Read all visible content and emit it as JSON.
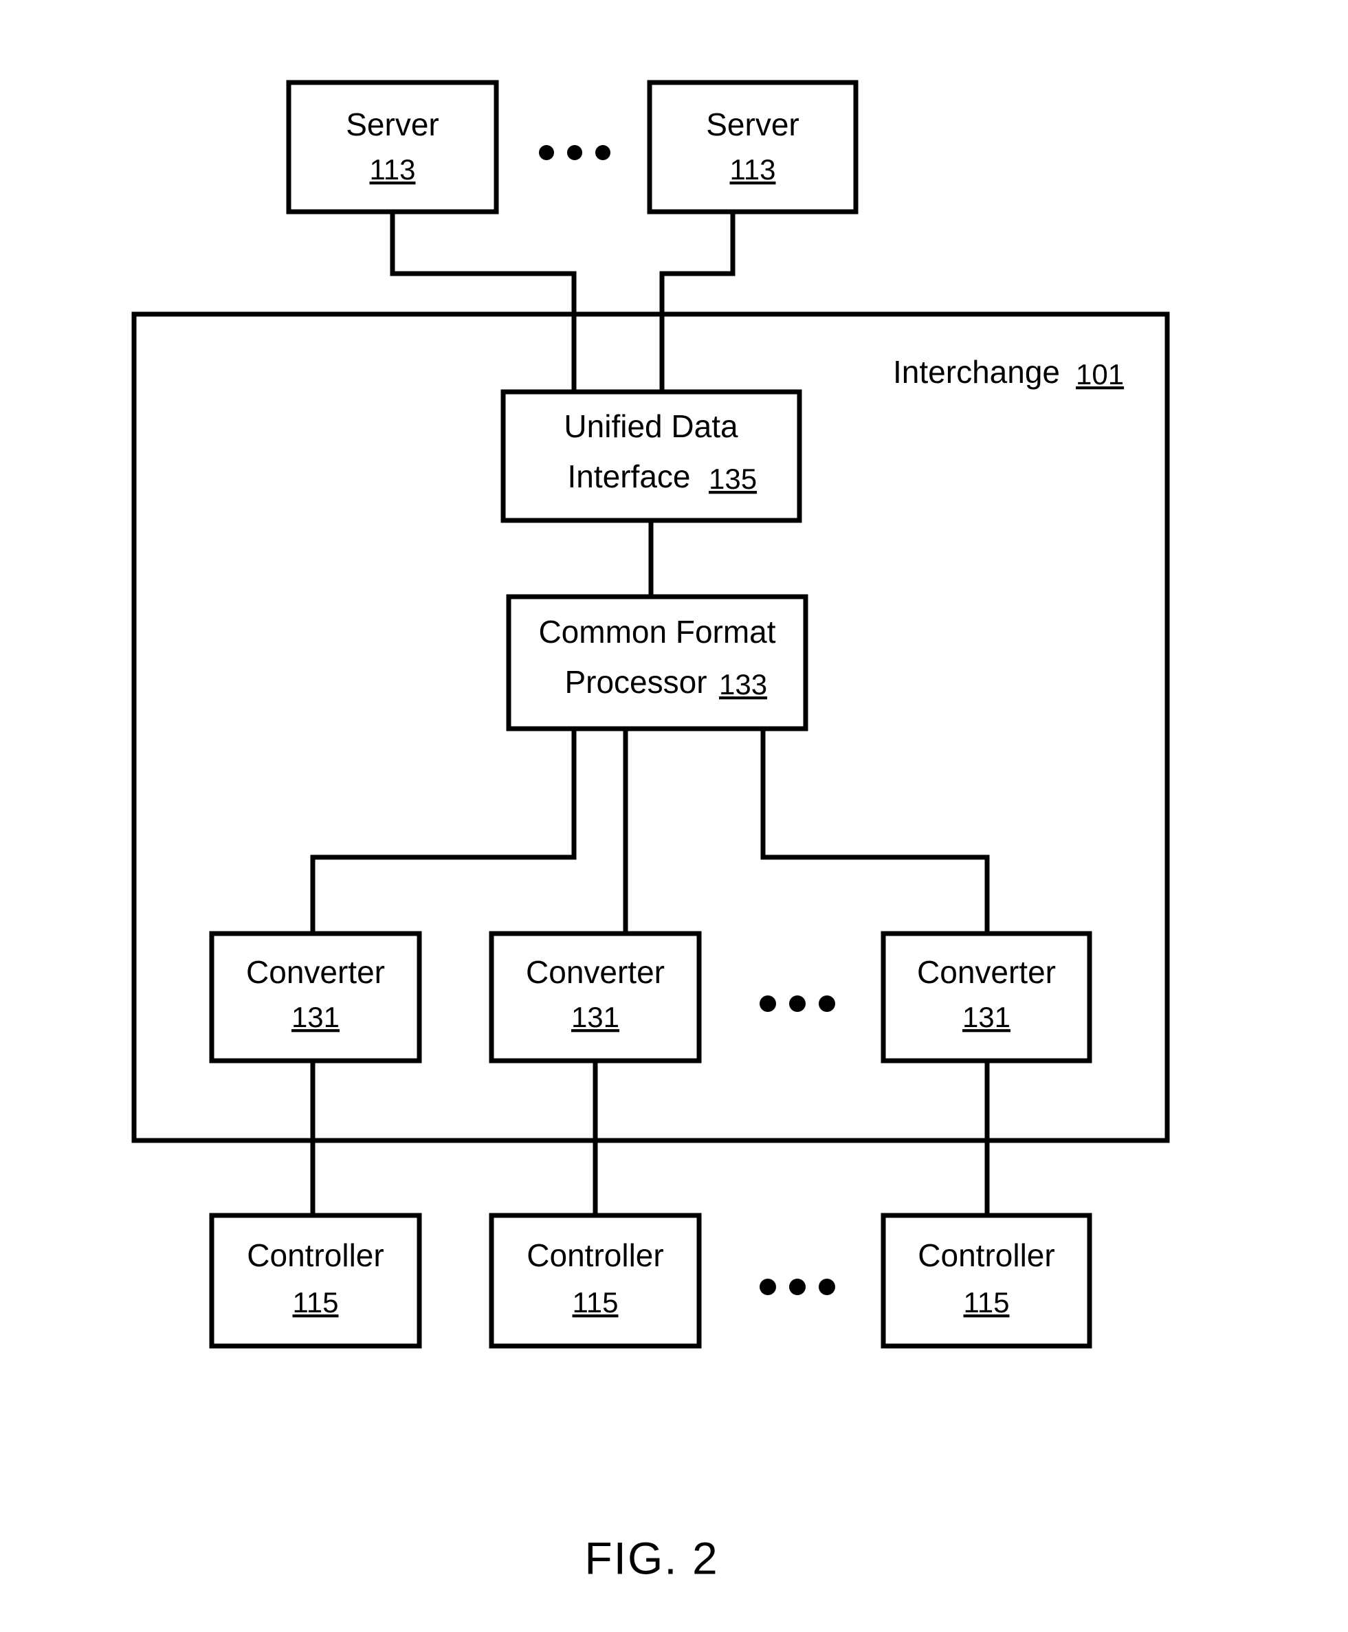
{
  "figure": {
    "caption": "FIG. 2",
    "type": "patent-block-diagram"
  },
  "container": {
    "label": "Interchange",
    "ref": "101"
  },
  "servers": [
    {
      "label": "Server",
      "ref": "113"
    },
    {
      "label": "Server",
      "ref": "113"
    }
  ],
  "unified_data_interface": {
    "line1": "Unified Data",
    "line2": "Interface",
    "ref": "135"
  },
  "common_format_processor": {
    "line1": "Common Format",
    "line2": "Processor",
    "ref": "133"
  },
  "converters": [
    {
      "label": "Converter",
      "ref": "131"
    },
    {
      "label": "Converter",
      "ref": "131"
    },
    {
      "label": "Converter",
      "ref": "131"
    }
  ],
  "controllers": [
    {
      "label": "Controller",
      "ref": "115"
    },
    {
      "label": "Controller",
      "ref": "115"
    },
    {
      "label": "Controller",
      "ref": "115"
    }
  ],
  "ellipses": [
    {
      "name": "server-row-ellipsis"
    },
    {
      "name": "converter-row-ellipsis"
    },
    {
      "name": "controller-row-ellipsis"
    }
  ],
  "colors": {
    "stroke": "#000000",
    "fill": "#ffffff",
    "background": "#ffffff"
  }
}
